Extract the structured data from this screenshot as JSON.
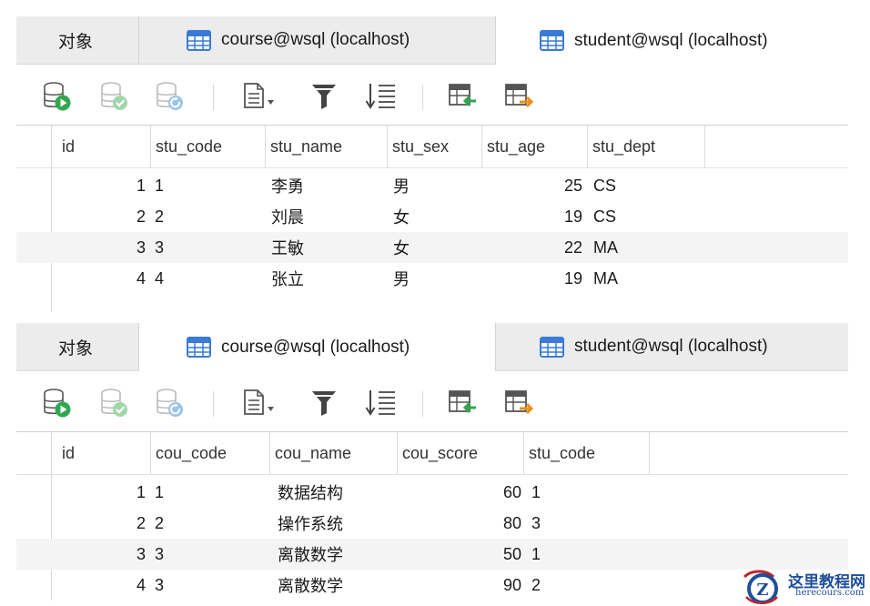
{
  "tabs": {
    "objects": "对象",
    "course": "course@wsql (localhost)",
    "student": "student@wsql (localhost)"
  },
  "toolbar": [
    {
      "icon": "db-run-icon"
    },
    {
      "icon": "db-apply-icon"
    },
    {
      "icon": "db-refresh-icon"
    },
    {
      "icon": "text-view-icon"
    },
    {
      "icon": "filter-icon"
    },
    {
      "icon": "sort-icon"
    },
    {
      "icon": "import-icon"
    },
    {
      "icon": "export-icon"
    }
  ],
  "student_grid": {
    "columns": [
      "id",
      "stu_code",
      "stu_name",
      "stu_sex",
      "stu_age",
      "stu_dept"
    ],
    "rows": [
      [
        "1",
        "1",
        "李勇",
        "男",
        "25",
        "CS"
      ],
      [
        "2",
        "2",
        "刘晨",
        "女",
        "19",
        "CS"
      ],
      [
        "3",
        "3",
        "王敏",
        "女",
        "22",
        "MA"
      ],
      [
        "4",
        "4",
        "张立",
        "男",
        "19",
        "MA"
      ]
    ]
  },
  "course_grid": {
    "columns": [
      "id",
      "cou_code",
      "cou_name",
      "cou_score",
      "stu_code"
    ],
    "rows": [
      [
        "1",
        "1",
        "数据结构",
        "60",
        "1"
      ],
      [
        "2",
        "2",
        "操作系统",
        "80",
        "3"
      ],
      [
        "3",
        "3",
        "离散数学",
        "50",
        "1"
      ],
      [
        "4",
        "3",
        "离散数学",
        "90",
        "2"
      ]
    ]
  },
  "watermark": {
    "title": "这里教程网",
    "url": "herecours.com"
  },
  "colors": {
    "accent_blue": "#3a7bd5",
    "run_green": "#2fa84f",
    "watermark_blue": "#1f4f9b"
  }
}
